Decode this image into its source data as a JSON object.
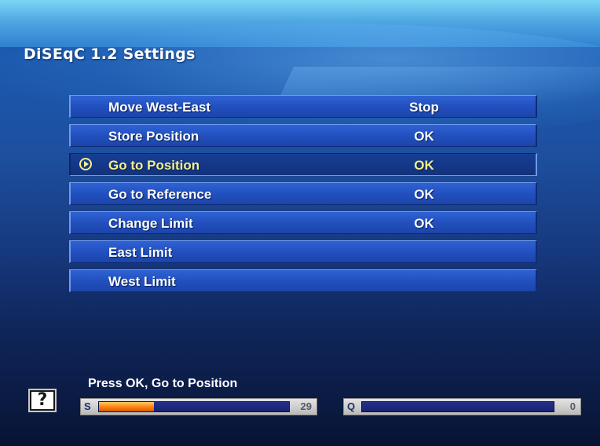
{
  "header": {
    "title": "DiSEqC 1.2 Settings"
  },
  "menu": {
    "items": [
      {
        "label": "Move West-East",
        "value": "Stop",
        "selected": false
      },
      {
        "label": "Store Position",
        "value": "OK",
        "selected": false
      },
      {
        "label": "Go to Position",
        "value": "OK",
        "selected": true
      },
      {
        "label": "Go to Reference",
        "value": "OK",
        "selected": false
      },
      {
        "label": "Change Limit",
        "value": "OK",
        "selected": false
      },
      {
        "label": "East Limit",
        "value": "",
        "selected": false
      },
      {
        "label": "West Limit",
        "value": "",
        "selected": false
      }
    ]
  },
  "footer": {
    "help_icon": "?",
    "hint": "Press OK, Go to Position",
    "signal": {
      "tag": "S",
      "value": "29",
      "level_percent": 29
    },
    "quality": {
      "tag": "Q",
      "value": "0",
      "level_percent": 0
    }
  },
  "colors": {
    "selected_text": "#f5f08a",
    "signal_fill": "#ff8a1a",
    "row_bg": "#2250bf"
  },
  "icons": {
    "cursor": "play-circle-icon",
    "help": "help-icon"
  }
}
